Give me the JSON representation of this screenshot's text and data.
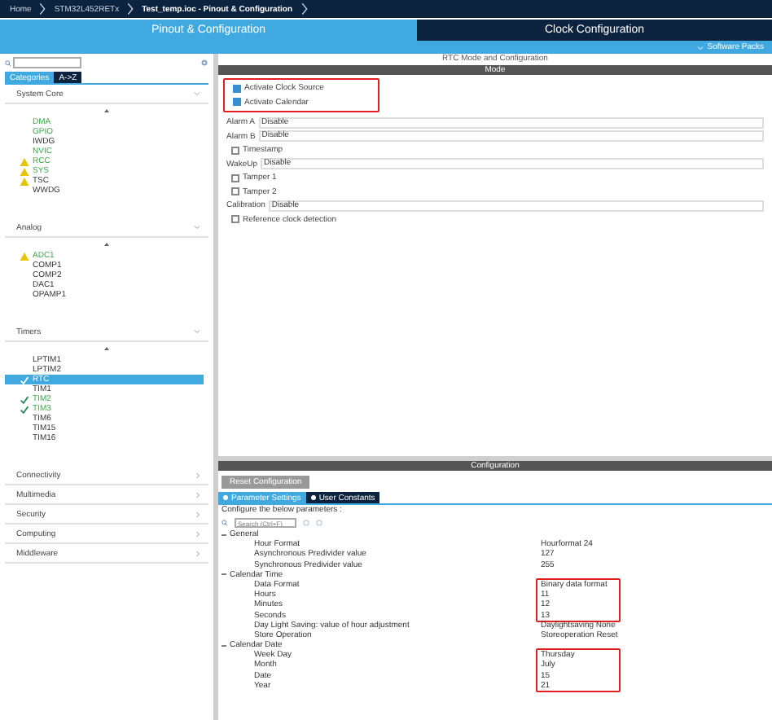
{
  "breadcrumb": [
    {
      "label": "Home",
      "current": false
    },
    {
      "label": "STM32L452RETx",
      "current": false
    },
    {
      "label": "Test_temp.ioc - Pinout & Configuration",
      "current": true
    }
  ],
  "tabs": [
    {
      "label": "Pinout & Configuration",
      "selected": true
    },
    {
      "label": "Clock Configuration",
      "selected": false
    }
  ],
  "software_packs": "Software Packs",
  "view_tabs": [
    {
      "label": "Categories",
      "selected": true
    },
    {
      "label": "A->Z",
      "selected": false
    }
  ],
  "categories": [
    {
      "name": "System Core",
      "expanded": true,
      "items": [
        {
          "label": "DMA",
          "kind": "plain",
          "configured": true,
          "selected": false
        },
        {
          "label": "GPIO",
          "kind": "plain",
          "configured": true,
          "selected": false
        },
        {
          "label": "IWDG",
          "kind": "plain",
          "configured": false,
          "selected": false
        },
        {
          "label": "NVIC",
          "kind": "plain",
          "configured": true,
          "selected": false
        },
        {
          "label": "RCC",
          "kind": "warning",
          "configured": true,
          "selected": false
        },
        {
          "label": "SYS",
          "kind": "warning",
          "configured": true,
          "selected": false
        },
        {
          "label": "TSC",
          "kind": "warning",
          "configured": false,
          "selected": false
        },
        {
          "label": "WWDG",
          "kind": "plain",
          "configured": false,
          "selected": false
        }
      ]
    },
    {
      "name": "Analog",
      "expanded": true,
      "items": [
        {
          "label": "ADC1",
          "kind": "warning",
          "configured": true,
          "selected": false
        },
        {
          "label": "COMP1",
          "kind": "plain",
          "configured": false,
          "selected": false
        },
        {
          "label": "COMP2",
          "kind": "plain",
          "configured": false,
          "selected": false
        },
        {
          "label": "DAC1",
          "kind": "plain",
          "configured": false,
          "selected": false
        },
        {
          "label": "OPAMP1",
          "kind": "plain",
          "configured": false,
          "selected": false
        }
      ]
    },
    {
      "name": "Timers",
      "expanded": true,
      "items": [
        {
          "label": "LPTIM1",
          "kind": "plain",
          "configured": false,
          "selected": false
        },
        {
          "label": "LPTIM2",
          "kind": "plain",
          "configured": false,
          "selected": false
        },
        {
          "label": "RTC",
          "kind": "check",
          "configured": true,
          "selected": true
        },
        {
          "label": "TIM1",
          "kind": "plain",
          "configured": false,
          "selected": false
        },
        {
          "label": "TIM2",
          "kind": "check",
          "configured": true,
          "selected": false
        },
        {
          "label": "TIM3",
          "kind": "check",
          "configured": true,
          "selected": false
        },
        {
          "label": "TIM6",
          "kind": "plain",
          "configured": false,
          "selected": false
        },
        {
          "label": "TIM15",
          "kind": "plain",
          "configured": false,
          "selected": false
        },
        {
          "label": "TIM16",
          "kind": "plain",
          "configured": false,
          "selected": false
        }
      ]
    },
    {
      "name": "Connectivity",
      "expanded": false
    },
    {
      "name": "Multimedia",
      "expanded": false
    },
    {
      "name": "Security",
      "expanded": false
    },
    {
      "name": "Computing",
      "expanded": false
    },
    {
      "name": "Middleware",
      "expanded": false
    }
  ],
  "panel_title": "RTC Mode and Configuration",
  "mode": {
    "header": "Mode",
    "groups": [
      {
        "highlighted": true,
        "rows": [
          {
            "kind": "checkbox",
            "label": "Activate Clock Source",
            "checked": true
          },
          {
            "kind": "checkbox",
            "label": "Activate Calendar",
            "checked": true
          }
        ]
      },
      {
        "highlighted": false,
        "rows": [
          {
            "kind": "select",
            "label": "Alarm A",
            "value": "Disable"
          },
          {
            "kind": "select",
            "label": "Alarm B",
            "value": "Disable"
          },
          {
            "kind": "checkbox",
            "label": "Timestamp",
            "checked": false
          },
          {
            "kind": "select",
            "label": "WakeUp",
            "value": "Disable"
          },
          {
            "kind": "checkbox",
            "label": "Tamper 1",
            "checked": false
          },
          {
            "kind": "checkbox",
            "label": "Tamper 2",
            "checked": false
          },
          {
            "kind": "select",
            "label": "Calibration",
            "value": "Disable"
          },
          {
            "kind": "checkbox",
            "label": "Reference clock detection",
            "checked": false
          }
        ]
      }
    ]
  },
  "configuration": {
    "header": "Configuration",
    "reset_button": "Reset Configuration",
    "tabs": [
      {
        "label": "Parameter Settings",
        "selected": true
      },
      {
        "label": "User Constants",
        "selected": false
      }
    ],
    "hint": "Configure the below parameters :",
    "search": {
      "placeholder": "Search (Ctrl+F)"
    },
    "sections": [
      {
        "title": "General",
        "expanded": true,
        "groups": [
          {
            "highlighted": false,
            "rows": [
              {
                "name": "Hour Format",
                "value": "Hourformat 24"
              },
              {
                "name": "Asynchronous Predivider value",
                "value": "127"
              },
              {
                "name": "Synchronous Predivider value",
                "value": "255"
              }
            ]
          }
        ]
      },
      {
        "title": "Calendar Time",
        "expanded": true,
        "groups": [
          {
            "highlighted": true,
            "rows": [
              {
                "name": "Data Format",
                "value": "Binary data format"
              },
              {
                "name": "Hours",
                "value": "11"
              },
              {
                "name": "Minutes",
                "value": "12"
              },
              {
                "name": "Seconds",
                "value": "13"
              }
            ]
          },
          {
            "highlighted": false,
            "rows": [
              {
                "name": "Day Light Saving: value of hour adjustment",
                "value": "Daylightsaving None"
              },
              {
                "name": "Store Operation",
                "value": "Storeoperation Reset"
              }
            ]
          }
        ]
      },
      {
        "title": "Calendar Date",
        "expanded": true,
        "groups": [
          {
            "highlighted": true,
            "rows": [
              {
                "name": "Week Day",
                "value": "Thursday"
              },
              {
                "name": "Month",
                "value": "July"
              },
              {
                "name": "Date",
                "value": "15"
              },
              {
                "name": "Year",
                "value": "21"
              }
            ]
          }
        ]
      }
    ]
  }
}
